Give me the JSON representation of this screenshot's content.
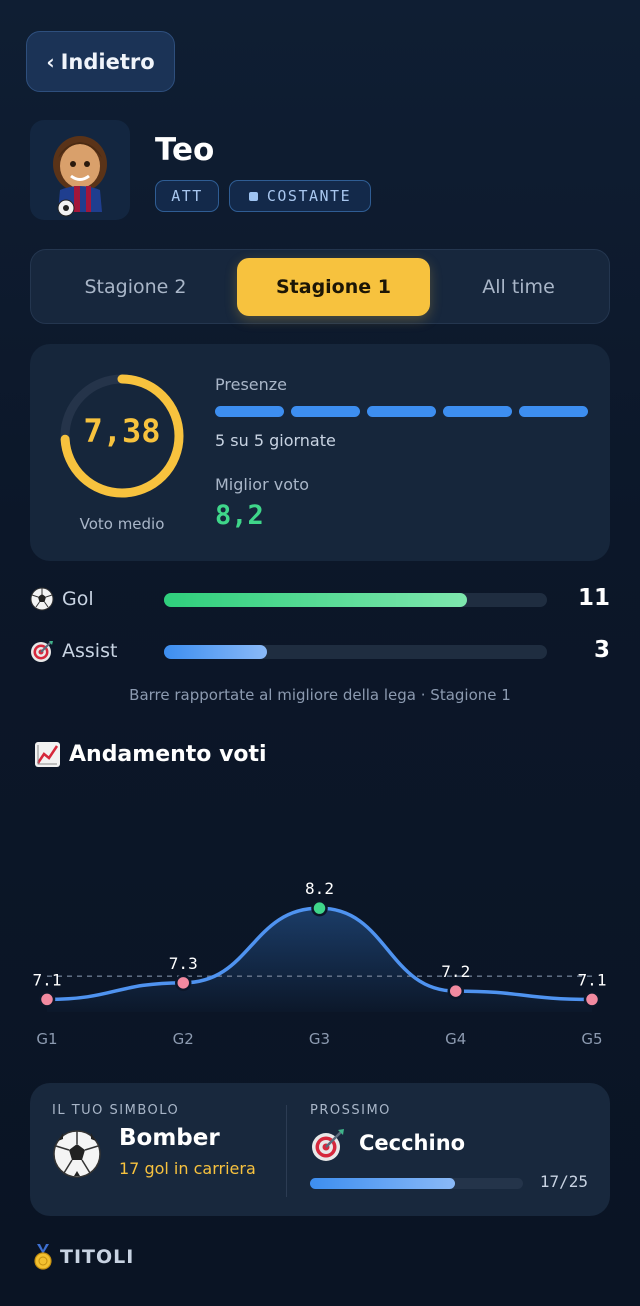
{
  "header": {
    "back_label": "Indietro"
  },
  "player": {
    "name": "Teo",
    "role_tag": "ATT",
    "style_tag": "COSTANTE"
  },
  "season_tabs": [
    {
      "label": "Stagione 2",
      "active": false
    },
    {
      "label": "Stagione 1",
      "active": true
    },
    {
      "label": "All time",
      "active": false
    }
  ],
  "stats": {
    "average_value": "7,38",
    "average_fraction": 0.74,
    "average_caption": "Voto medio",
    "appearances_label": "Presenze",
    "appearances_text": "5 su 5 giornate",
    "appearances": 5,
    "matchdays": 5,
    "best_label": "Miglior voto",
    "best_value": "8,2"
  },
  "metrics": [
    {
      "label": "Gol",
      "value": "11",
      "fraction": 0.79,
      "icon": "soccer-ball-icon"
    },
    {
      "label": "Assist",
      "value": "3",
      "fraction": 0.27,
      "icon": "target-icon"
    }
  ],
  "metrics_note": "Barre rapportate al migliore della lega · Stagione 1",
  "trend": {
    "title": "Andamento voti",
    "icon": "chart-increasing-icon"
  },
  "chart_data": {
    "type": "line",
    "title": "Andamento voti",
    "categories": [
      "G1",
      "G2",
      "G3",
      "G4",
      "G5"
    ],
    "values": [
      7.1,
      7.3,
      8.2,
      7.2,
      7.1
    ],
    "value_labels": [
      "7.1",
      "7.3",
      "8.2",
      "7.2",
      "7.1"
    ],
    "reference_line": 7.38,
    "highlight_index": 2,
    "ylim": [
      6.9,
      8.25
    ],
    "grid": false,
    "line_color": "#4f93f0",
    "point_color": "#f28aa0",
    "highlight_color": "#3fd68a"
  },
  "symbol": {
    "caption": "IL TUO SIMBOLO",
    "name": "Bomber",
    "subtitle": "17 gol in carriera",
    "icon": "soccer-ball-icon"
  },
  "next": {
    "caption": "PROSSIMO",
    "name": "Cecchino",
    "progress_text": "17/25",
    "progress": 0.68,
    "icon": "target-icon"
  },
  "titles": {
    "label": "TITOLI",
    "icon": "medal-icon"
  },
  "colors": {
    "accent": "#f7c23e",
    "primary_blue": "#3d8ef0",
    "success": "#3fd68a"
  }
}
